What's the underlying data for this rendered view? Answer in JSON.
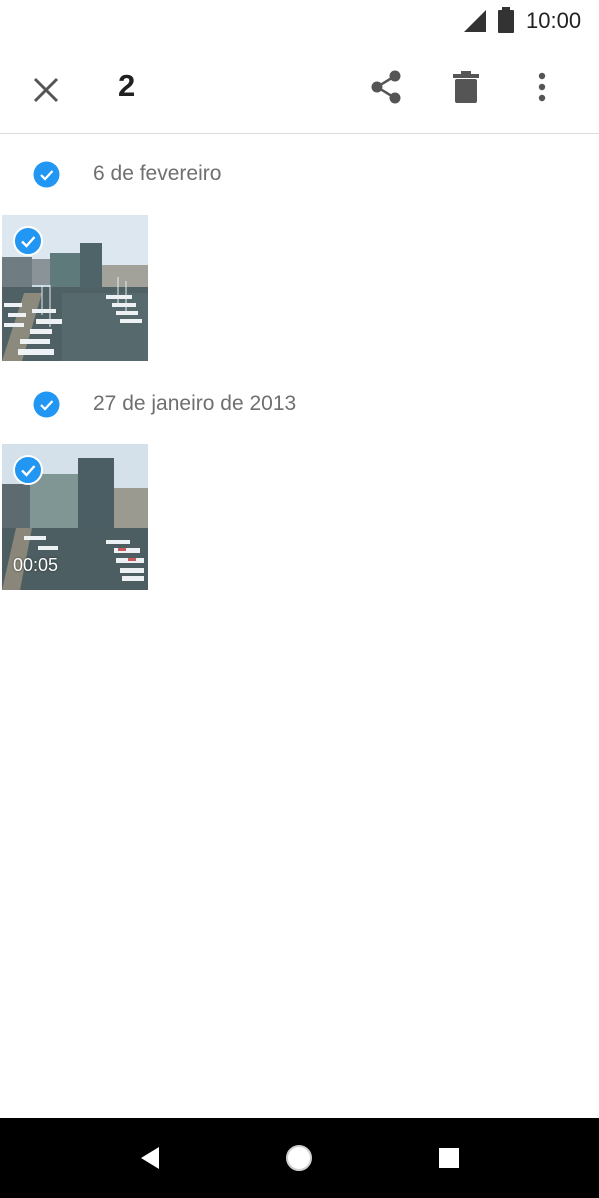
{
  "status_bar": {
    "time": "10:00",
    "icons": [
      "signal-icon",
      "battery-icon"
    ]
  },
  "action_bar": {
    "close_icon": "close-icon",
    "selected_count": "2",
    "share_icon": "share-icon",
    "delete_icon": "trash-icon",
    "more_icon": "more-vert-icon"
  },
  "groups": [
    {
      "date": "6 de fevereiro",
      "items": [
        {
          "type": "photo",
          "selected": true
        }
      ]
    },
    {
      "date": "27 de janeiro de 2013",
      "items": [
        {
          "type": "video",
          "selected": true,
          "duration": "00:05"
        }
      ]
    }
  ],
  "colors": {
    "accent": "#2196F3",
    "date_text": "#6f6f6f",
    "navbar": "#000000"
  },
  "nav_bar": {
    "icons": [
      "back-icon",
      "home-icon",
      "recents-icon"
    ]
  }
}
